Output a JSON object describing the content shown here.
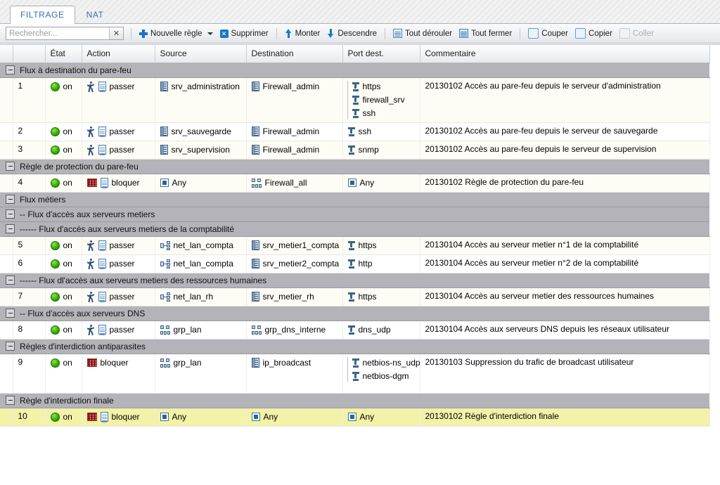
{
  "tabs": [
    {
      "label": "FILTRAGE",
      "active": true
    },
    {
      "label": "NAT",
      "active": false
    }
  ],
  "search": {
    "value": "",
    "placeholder": "Rechercher...",
    "clear_label": "✕"
  },
  "toolbar": [
    {
      "name": "new-rule-button",
      "label": "Nouvelle règle",
      "icon": "plus-icon",
      "caret": true,
      "disabled": false
    },
    {
      "name": "delete-button",
      "label": "Supprimer",
      "icon": "delete-icon",
      "caret": false,
      "disabled": false
    },
    {
      "name": "move-up-button",
      "label": "Monter",
      "icon": "arrow-up-icon",
      "caret": false,
      "disabled": false
    },
    {
      "name": "move-down-button",
      "label": "Descendre",
      "icon": "arrow-down-icon",
      "caret": false,
      "disabled": false
    },
    {
      "name": "expand-all-button",
      "label": "Tout dérouler",
      "icon": "expand-all-icon",
      "caret": false,
      "disabled": false
    },
    {
      "name": "collapse-all-button",
      "label": "Tout fermer",
      "icon": "collapse-all-icon",
      "caret": false,
      "disabled": false
    },
    {
      "name": "cut-button",
      "label": "Couper",
      "icon": "cut-icon",
      "caret": false,
      "disabled": false
    },
    {
      "name": "copy-button",
      "label": "Copier",
      "icon": "copy-icon",
      "caret": false,
      "disabled": false
    },
    {
      "name": "paste-button",
      "label": "Coller",
      "icon": "paste-icon",
      "caret": false,
      "disabled": true
    }
  ],
  "columns": [
    {
      "key": "expander",
      "label": ""
    },
    {
      "key": "num",
      "label": ""
    },
    {
      "key": "etat",
      "label": "État"
    },
    {
      "key": "action",
      "label": "Action"
    },
    {
      "key": "source",
      "label": "Source"
    },
    {
      "key": "destination",
      "label": "Destination"
    },
    {
      "key": "port",
      "label": "Port dest."
    },
    {
      "key": "commentaire",
      "label": "Commentaire"
    }
  ],
  "rows": [
    {
      "type": "group",
      "label": "Flux à destination du pare-feu",
      "expander": "collapse-icon"
    },
    {
      "type": "rule",
      "num": "1",
      "highlight": "cream",
      "tall": true,
      "etat": {
        "text": "on",
        "icon": "status-on-icon"
      },
      "action": {
        "text": "passer",
        "icons": [
          "person-icon",
          "document-icon"
        ]
      },
      "source": {
        "text": "srv_administration",
        "icon": "server-icon"
      },
      "destination": {
        "text": "Firewall_admin",
        "icon": "server-icon"
      },
      "ports": [
        {
          "text": "https",
          "icon": "port-icon"
        },
        {
          "text": "firewall_srv",
          "icon": "port-icon"
        },
        {
          "text": "ssh",
          "icon": "port-icon"
        }
      ],
      "commentaire": "20130102 Accès au pare-feu depuis le serveur d'administration"
    },
    {
      "type": "rule",
      "num": "2",
      "highlight": "white",
      "tall": false,
      "etat": {
        "text": "on",
        "icon": "status-on-icon"
      },
      "action": {
        "text": "passer",
        "icons": [
          "person-icon",
          "document-icon"
        ]
      },
      "source": {
        "text": "srv_sauvegarde",
        "icon": "server-icon"
      },
      "destination": {
        "text": "Firewall_admin",
        "icon": "server-icon"
      },
      "ports": [
        {
          "text": "ssh",
          "icon": "port-icon"
        }
      ],
      "commentaire": "20130102 Accès au pare-feu depuis le serveur de sauvegarde"
    },
    {
      "type": "rule",
      "num": "3",
      "highlight": "cream",
      "tall": false,
      "etat": {
        "text": "on",
        "icon": "status-on-icon"
      },
      "action": {
        "text": "passer",
        "icons": [
          "person-icon",
          "document-icon"
        ]
      },
      "source": {
        "text": "srv_supervision",
        "icon": "server-icon"
      },
      "destination": {
        "text": "Firewall_admin",
        "icon": "server-icon"
      },
      "ports": [
        {
          "text": "snmp",
          "icon": "port-icon"
        }
      ],
      "commentaire": "20130102 Accès au pare-feu depuis le serveur de supervision"
    },
    {
      "type": "group",
      "label": "Règle de protection du pare-feu",
      "expander": "collapse-icon"
    },
    {
      "type": "rule",
      "num": "4",
      "highlight": "cream",
      "tall": false,
      "etat": {
        "text": "on",
        "icon": "status-on-icon"
      },
      "action": {
        "text": "bloquer",
        "icons": [
          "brick-wall-icon",
          "document-icon"
        ]
      },
      "source": {
        "text": "Any",
        "icon": "any-icon"
      },
      "destination": {
        "text": "Firewall_all",
        "icon": "group-icon"
      },
      "ports": [
        {
          "text": "Any",
          "icon": "any-icon"
        }
      ],
      "commentaire": "20130102 Règle de protection du pare-feu"
    },
    {
      "type": "group",
      "label": "Flux métiers",
      "expander": "collapse-icon"
    },
    {
      "type": "group",
      "label": "-- Flux d'accès aux serveurs metiers",
      "expander": "collapse-icon"
    },
    {
      "type": "group",
      "label": "------ Flux d'accès aux serveurs metiers de la comptabilité",
      "expander": "collapse-icon"
    },
    {
      "type": "rule",
      "num": "5",
      "highlight": "cream",
      "tall": false,
      "etat": {
        "text": "on",
        "icon": "status-on-icon"
      },
      "action": {
        "text": "passer",
        "icons": [
          "person-icon",
          "document-icon"
        ]
      },
      "source": {
        "text": "net_lan_compta",
        "icon": "network-icon"
      },
      "destination": {
        "text": "srv_metier1_compta",
        "icon": "server-icon"
      },
      "ports": [
        {
          "text": "https",
          "icon": "port-icon"
        }
      ],
      "commentaire": "20130104 Accès au serveur metier n°1 de la comptabilité"
    },
    {
      "type": "rule",
      "num": "6",
      "highlight": "white",
      "tall": false,
      "etat": {
        "text": "on",
        "icon": "status-on-icon"
      },
      "action": {
        "text": "passer",
        "icons": [
          "person-icon",
          "document-icon"
        ]
      },
      "source": {
        "text": "net_lan_compta",
        "icon": "network-icon"
      },
      "destination": {
        "text": "srv_metier2_compta",
        "icon": "server-icon"
      },
      "ports": [
        {
          "text": "http",
          "icon": "port-icon"
        }
      ],
      "commentaire": "20130104 Accès au serveur metier n°2 de la comptabilité"
    },
    {
      "type": "group",
      "label": "------ Flux dl'accès aux serveurs metiers des ressources humaines",
      "expander": "collapse-icon"
    },
    {
      "type": "rule",
      "num": "7",
      "highlight": "cream",
      "tall": false,
      "etat": {
        "text": "on",
        "icon": "status-on-icon"
      },
      "action": {
        "text": "passer",
        "icons": [
          "person-icon",
          "document-icon"
        ]
      },
      "source": {
        "text": "net_lan_rh",
        "icon": "network-icon"
      },
      "destination": {
        "text": "srv_metier_rh",
        "icon": "server-icon"
      },
      "ports": [
        {
          "text": "https",
          "icon": "port-icon"
        }
      ],
      "commentaire": "20130104 Accès au serveur metier des ressources humaines"
    },
    {
      "type": "group",
      "label": "-- Flux d'accès aux serveurs DNS",
      "expander": "collapse-icon"
    },
    {
      "type": "rule",
      "num": "8",
      "highlight": "white",
      "tall": false,
      "etat": {
        "text": "on",
        "icon": "status-on-icon"
      },
      "action": {
        "text": "passer",
        "icons": [
          "person-icon",
          "document-icon"
        ]
      },
      "source": {
        "text": "grp_lan",
        "icon": "group-icon"
      },
      "destination": {
        "text": "grp_dns_interne",
        "icon": "group-icon"
      },
      "ports": [
        {
          "text": "dns_udp",
          "icon": "port-icon"
        }
      ],
      "commentaire": "20130104 Accès aux serveurs DNS depuis les réseaux utilisateur"
    },
    {
      "type": "group",
      "label": "Règles d'interdiction antiparasites",
      "expander": "collapse-icon"
    },
    {
      "type": "rule",
      "num": "9",
      "highlight": "white",
      "tall": true,
      "etat": {
        "text": "on",
        "icon": "status-on-icon"
      },
      "action": {
        "text": "bloquer",
        "icons": [
          "brick-wall-icon"
        ]
      },
      "source": {
        "text": "grp_lan",
        "icon": "group-icon"
      },
      "destination": {
        "text": "ip_broadcast",
        "icon": "server-icon"
      },
      "ports": [
        {
          "text": "netbios-ns_udp",
          "icon": "port-icon"
        },
        {
          "text": "netbios-dgm",
          "icon": "port-icon"
        }
      ],
      "commentaire": "20130103 Suppression du trafic de broadcast utilisateur"
    },
    {
      "type": "group",
      "label": "Règle d'interdiction finale",
      "expander": "collapse-icon"
    },
    {
      "type": "rule",
      "num": "10",
      "highlight": "selected",
      "tall": false,
      "etat": {
        "text": "on",
        "icon": "status-on-icon"
      },
      "action": {
        "text": "bloquer",
        "icons": [
          "brick-wall-icon",
          "document-icon"
        ]
      },
      "source": {
        "text": "Any",
        "icon": "any-icon"
      },
      "destination": {
        "text": "Any",
        "icon": "any-icon"
      },
      "ports": [
        {
          "text": "Any",
          "icon": "any-icon"
        }
      ],
      "commentaire": "20130102 Règle d'interdiction finale"
    }
  ],
  "colors": {
    "group_header_bg": "#b3b3b9",
    "row_cream": "#fdfdf5",
    "row_white": "#ffffff",
    "row_selected": "#f2f2a8",
    "status_on": "#36b000",
    "block_red": "#b13a3a",
    "accent_blue": "#1878c8",
    "tab_text": "#3a6ea5"
  }
}
